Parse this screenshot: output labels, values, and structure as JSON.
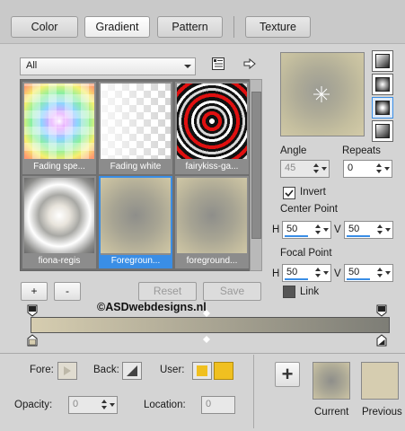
{
  "tabs": [
    {
      "label": "Color"
    },
    {
      "label": "Gradient"
    },
    {
      "label": "Pattern"
    },
    {
      "label": "Texture"
    }
  ],
  "filter": {
    "selected": "All"
  },
  "gradients": [
    {
      "name": "Fading spe..."
    },
    {
      "name": "Fading white"
    },
    {
      "name": "fairykiss-ga..."
    },
    {
      "name": "fiona-regis"
    },
    {
      "name": "Foregroun..."
    },
    {
      "name": "foreground..."
    }
  ],
  "buttons": {
    "add": "+",
    "remove": "-",
    "reset": "Reset",
    "save": "Save"
  },
  "watermark": "©ASDwebdesigns.nl",
  "angle": {
    "label": "Angle",
    "value": "45"
  },
  "repeats": {
    "label": "Repeats",
    "value": "0"
  },
  "invert": {
    "label": "Invert",
    "checked": true
  },
  "center": {
    "label": "Center Point",
    "h_label": "H",
    "h": "50",
    "v_label": "V",
    "v": "50"
  },
  "focal": {
    "label": "Focal Point",
    "h_label": "H",
    "h": "50",
    "v_label": "V",
    "v": "50"
  },
  "link": {
    "label": "Link",
    "checked": false
  },
  "bottom": {
    "fore": "Fore:",
    "back": "Back:",
    "user": "User:",
    "opacity": "Opacity:",
    "opacity_value": "0",
    "location": "Location:",
    "location_value": "0",
    "current": "Current",
    "previous": "Previous"
  },
  "colors": {
    "accent": "#3a8ee6",
    "user_swatch": "#f0c020",
    "gradient_start": "#d6cdb0",
    "gradient_end": "#7d7d76"
  }
}
